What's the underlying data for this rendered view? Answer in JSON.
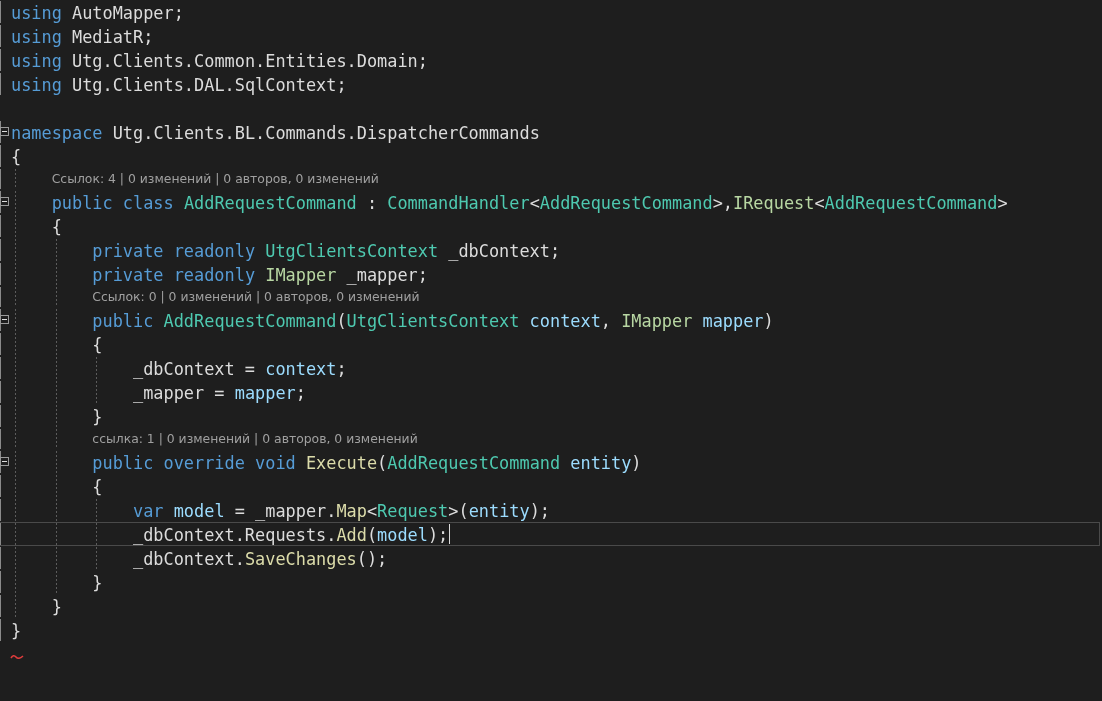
{
  "editor": {
    "lines": [
      {
        "kind": "code",
        "tokens": [
          {
            "text": "using ",
            "color": "#569cd6"
          },
          {
            "text": "AutoMapper;",
            "color": "#dcdcdc"
          }
        ]
      },
      {
        "kind": "code",
        "tokens": [
          {
            "text": "using ",
            "color": "#569cd6"
          },
          {
            "text": "MediatR;",
            "color": "#dcdcdc"
          }
        ]
      },
      {
        "kind": "code",
        "tokens": [
          {
            "text": "using ",
            "color": "#569cd6"
          },
          {
            "text": "Utg.Clients.Common.Entities.Domain;",
            "color": "#dcdcdc"
          }
        ]
      },
      {
        "kind": "code",
        "tokens": [
          {
            "text": "using ",
            "color": "#569cd6"
          },
          {
            "text": "Utg.Clients.DAL.SqlContext;",
            "color": "#dcdcdc"
          }
        ]
      },
      {
        "kind": "blank"
      },
      {
        "kind": "code",
        "fold": true,
        "tokens": [
          {
            "text": "namespace ",
            "color": "#569cd6"
          },
          {
            "text": "Utg.Clients.BL.Commands.DispatcherCommands",
            "color": "#dcdcdc"
          }
        ]
      },
      {
        "kind": "code",
        "tokens": [
          {
            "text": "{",
            "color": "#dcdcdc"
          }
        ]
      },
      {
        "kind": "lens",
        "text": "    Ссылок: 4 | 0 изменений | 0 авторов, 0 изменений"
      },
      {
        "kind": "code",
        "fold": true,
        "tokens": [
          {
            "text": "    public class ",
            "color": "#569cd6"
          },
          {
            "text": "AddRequestCommand",
            "color": "#4ec9b0"
          },
          {
            "text": " : ",
            "color": "#dcdcdc"
          },
          {
            "text": "CommandHandler",
            "color": "#4ec9b0"
          },
          {
            "text": "<",
            "color": "#dcdcdc"
          },
          {
            "text": "AddRequestCommand",
            "color": "#4ec9b0"
          },
          {
            "text": ">,",
            "color": "#dcdcdc"
          },
          {
            "text": "IRequest",
            "color": "#b8d7a3"
          },
          {
            "text": "<",
            "color": "#dcdcdc"
          },
          {
            "text": "AddRequestCommand",
            "color": "#4ec9b0"
          },
          {
            "text": ">",
            "color": "#dcdcdc"
          }
        ]
      },
      {
        "kind": "code",
        "tokens": [
          {
            "text": "    {",
            "color": "#dcdcdc"
          }
        ]
      },
      {
        "kind": "code",
        "tokens": [
          {
            "text": "        private readonly ",
            "color": "#569cd6"
          },
          {
            "text": "UtgClientsContext",
            "color": "#4ec9b0"
          },
          {
            "text": " _dbContext;",
            "color": "#dcdcdc"
          }
        ]
      },
      {
        "kind": "code",
        "tokens": [
          {
            "text": "        private readonly ",
            "color": "#569cd6"
          },
          {
            "text": "IMapper",
            "color": "#b8d7a3"
          },
          {
            "text": " _mapper;",
            "color": "#dcdcdc"
          }
        ]
      },
      {
        "kind": "lens",
        "text": "        Ссылок: 0 | 0 изменений | 0 авторов, 0 изменений"
      },
      {
        "kind": "code",
        "fold": true,
        "tokens": [
          {
            "text": "        public ",
            "color": "#569cd6"
          },
          {
            "text": "AddRequestCommand",
            "color": "#4ec9b0"
          },
          {
            "text": "(",
            "color": "#dcdcdc"
          },
          {
            "text": "UtgClientsContext",
            "color": "#4ec9b0"
          },
          {
            "text": " context",
            "color": "#9cdcfe"
          },
          {
            "text": ", ",
            "color": "#dcdcdc"
          },
          {
            "text": "IMapper",
            "color": "#b8d7a3"
          },
          {
            "text": " mapper",
            "color": "#9cdcfe"
          },
          {
            "text": ")",
            "color": "#dcdcdc"
          }
        ]
      },
      {
        "kind": "code",
        "tokens": [
          {
            "text": "        {",
            "color": "#dcdcdc"
          }
        ]
      },
      {
        "kind": "code",
        "tokens": [
          {
            "text": "            _dbContext = ",
            "color": "#dcdcdc"
          },
          {
            "text": "context",
            "color": "#9cdcfe"
          },
          {
            "text": ";",
            "color": "#dcdcdc"
          }
        ]
      },
      {
        "kind": "code",
        "tokens": [
          {
            "text": "            _mapper = ",
            "color": "#dcdcdc"
          },
          {
            "text": "mapper",
            "color": "#9cdcfe"
          },
          {
            "text": ";",
            "color": "#dcdcdc"
          }
        ]
      },
      {
        "kind": "code",
        "tokens": [
          {
            "text": "        }",
            "color": "#dcdcdc"
          }
        ]
      },
      {
        "kind": "lens",
        "text": "        ссылка: 1 | 0 изменений | 0 авторов, 0 изменений"
      },
      {
        "kind": "code",
        "fold": true,
        "tokens": [
          {
            "text": "        public override void ",
            "color": "#569cd6"
          },
          {
            "text": "Execute",
            "color": "#dcdcaa"
          },
          {
            "text": "(",
            "color": "#dcdcdc"
          },
          {
            "text": "AddRequestCommand",
            "color": "#4ec9b0"
          },
          {
            "text": " entity",
            "color": "#9cdcfe"
          },
          {
            "text": ")",
            "color": "#dcdcdc"
          }
        ]
      },
      {
        "kind": "code",
        "tokens": [
          {
            "text": "        {",
            "color": "#dcdcdc"
          }
        ]
      },
      {
        "kind": "code",
        "tokens": [
          {
            "text": "            var ",
            "color": "#569cd6"
          },
          {
            "text": "model",
            "color": "#9cdcfe"
          },
          {
            "text": " = _mapper.",
            "color": "#dcdcdc"
          },
          {
            "text": "Map",
            "color": "#dcdcaa"
          },
          {
            "text": "<",
            "color": "#dcdcdc"
          },
          {
            "text": "Request",
            "color": "#4ec9b0"
          },
          {
            "text": ">(",
            "color": "#dcdcdc"
          },
          {
            "text": "entity",
            "color": "#9cdcfe"
          },
          {
            "text": ");",
            "color": "#dcdcdc"
          }
        ]
      },
      {
        "kind": "code",
        "current": true,
        "tokens": [
          {
            "text": "            _dbContext.Requests.",
            "color": "#dcdcdc"
          },
          {
            "text": "Add",
            "color": "#dcdcaa"
          },
          {
            "text": "(",
            "color": "#dcdcdc"
          },
          {
            "text": "model",
            "color": "#9cdcfe"
          },
          {
            "text": ");",
            "color": "#dcdcdc"
          }
        ]
      },
      {
        "kind": "code",
        "tokens": [
          {
            "text": "            _dbContext.",
            "color": "#dcdcdc"
          },
          {
            "text": "SaveChanges",
            "color": "#dcdcaa"
          },
          {
            "text": "();",
            "color": "#dcdcdc"
          }
        ]
      },
      {
        "kind": "code",
        "tokens": [
          {
            "text": "        }",
            "color": "#dcdcdc"
          }
        ]
      },
      {
        "kind": "code",
        "tokens": [
          {
            "text": "    }",
            "color": "#dcdcdc"
          }
        ]
      },
      {
        "kind": "code",
        "tokens": [
          {
            "text": "}",
            "color": "#dcdcdc"
          }
        ]
      },
      {
        "kind": "error"
      }
    ]
  }
}
